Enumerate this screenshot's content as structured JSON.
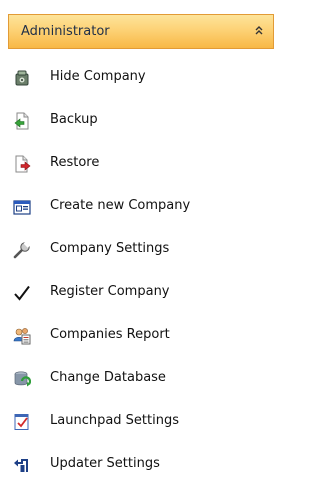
{
  "panel": {
    "title": "Administrator",
    "collapse_glyph": "˄˄"
  },
  "menu": {
    "items": [
      {
        "label": "Hide Company",
        "icon": "hide-company-icon"
      },
      {
        "label": "Backup",
        "icon": "backup-icon"
      },
      {
        "label": "Restore",
        "icon": "restore-icon"
      },
      {
        "label": "Create new Company",
        "icon": "create-company-icon"
      },
      {
        "label": "Company Settings",
        "icon": "settings-wrench-icon"
      },
      {
        "label": "Register Company",
        "icon": "checkmark-icon"
      },
      {
        "label": "Companies Report",
        "icon": "companies-report-icon"
      },
      {
        "label": "Change Database",
        "icon": "change-database-icon"
      },
      {
        "label": "Launchpad Settings",
        "icon": "launchpad-settings-icon"
      },
      {
        "label": "Updater Settings",
        "icon": "updater-settings-icon"
      }
    ]
  },
  "colors": {
    "header_top": "#fde49a",
    "header_bottom": "#f8b846",
    "header_border": "#e29b36",
    "text": "#111111"
  }
}
